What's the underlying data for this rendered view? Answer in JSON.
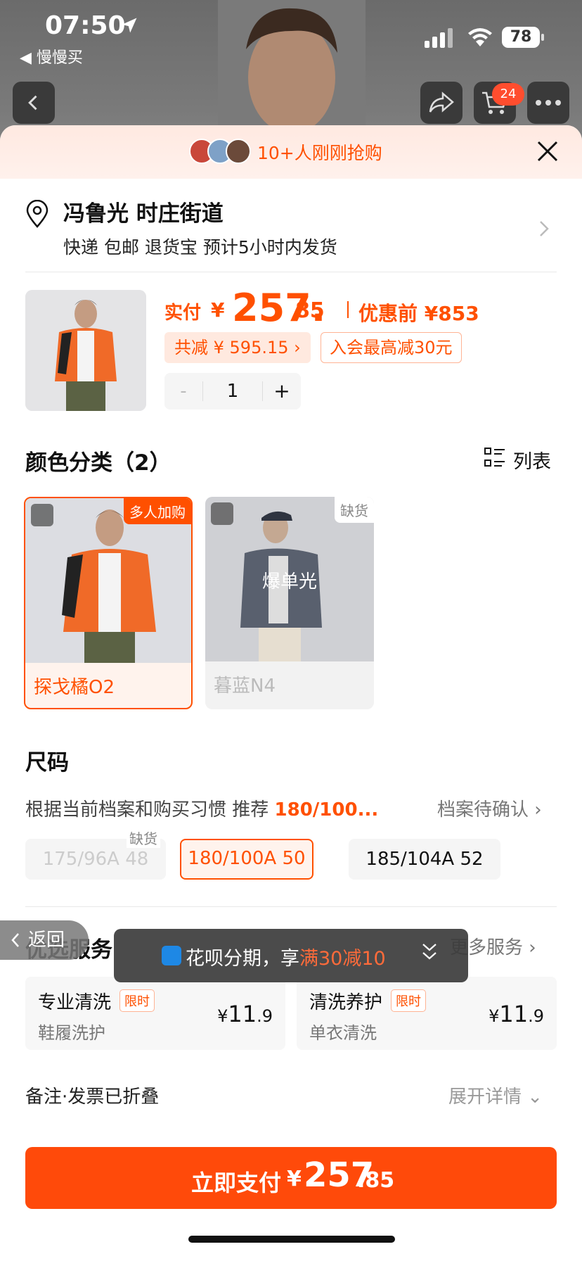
{
  "status_bar": {
    "time": "07:50",
    "back_app": "◀ 慢慢买",
    "battery": "78"
  },
  "top_bar": {
    "cart_count": "24"
  },
  "promo": {
    "text": "10+人刚刚抢购"
  },
  "address": {
    "name": "冯鲁光 时庄街道",
    "delivery": "快递 包邮 退货宝 预计5小时内发货"
  },
  "price": {
    "pay_label": "实付",
    "yen": "¥",
    "amount_int": "257.",
    "amount_dec": "85",
    "before_label": "优惠前 ¥853",
    "discount": "共减 ¥ 595.15 ›",
    "member": "入会最高减30元",
    "quantity": "1",
    "minus": "-",
    "plus": "+"
  },
  "color": {
    "title": "颜色分类（2）",
    "list_label": "列表",
    "options": [
      {
        "label": "探戈橘O2",
        "badge": "多人加购",
        "state": "selected"
      },
      {
        "label": "暮蓝N4",
        "badge": "缺货",
        "overlay": "爆单光",
        "state": "disabled"
      }
    ]
  },
  "size": {
    "title": "尺码",
    "rec_prefix": "根据当前档案和购买习惯 推荐",
    "rec_value": "180/100...",
    "pending": "档案待确认 ›",
    "oos_tag": "缺货",
    "options": [
      "175/96A 48",
      "180/100A 50",
      "185/104A 52"
    ]
  },
  "services": {
    "title": "优选服务",
    "more": "更多服务 ›",
    "items": [
      {
        "title": "专业清洗",
        "limit": "限时",
        "sub": "鞋履洗护",
        "yen": "¥",
        "price_int": "11",
        "price_dec": ".9"
      },
      {
        "title": "清洗养护",
        "limit": "限时",
        "sub": "单衣清洗",
        "yen": "¥",
        "price_int": "11",
        "price_dec": ".9"
      }
    ]
  },
  "note": {
    "label": "备注·发票已折叠",
    "expand": "展开详情 ⌄"
  },
  "back_pill": "返回",
  "toast": {
    "prefix": "花呗分期，享",
    "highlight": "满30减10"
  },
  "pay_button": {
    "label": "立即支付",
    "yen": "¥",
    "amount_int": "257",
    "amount_dec": ".85"
  },
  "colors": {
    "accent": "#ff5000",
    "button": "#ff4a0a"
  }
}
